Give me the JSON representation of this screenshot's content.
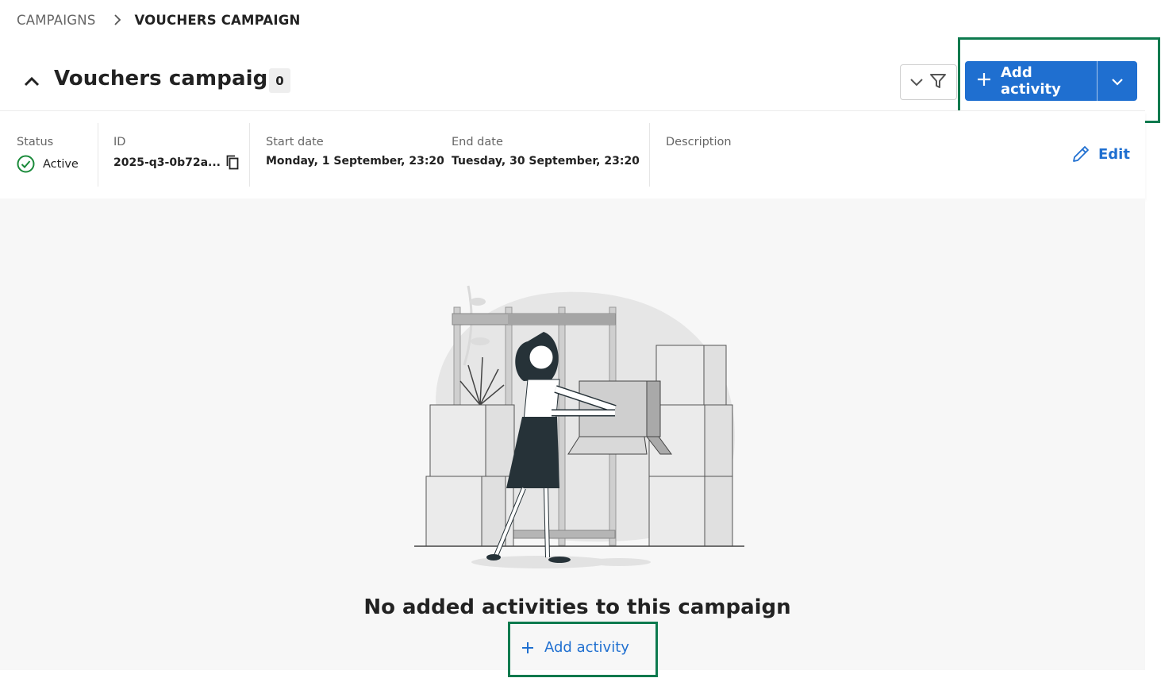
{
  "breadcrumb": {
    "parent": "CAMPAIGNS",
    "current": "VOUCHERS CAMPAIGN"
  },
  "header": {
    "title": "Vouchers campaign",
    "count": "0",
    "add_button_label": "Add activity"
  },
  "details": {
    "status_label": "Status",
    "status_value": "Active",
    "id_label": "ID",
    "id_value": "2025-q3-0b72a...",
    "start_label": "Start date",
    "start_value": "Monday, 1 September, 23:20",
    "end_label": "End date",
    "end_value": "Tuesday, 30 September, 23:20",
    "description_label": "Description",
    "edit_label": "Edit"
  },
  "empty_state": {
    "title": "No added activities to this campaign",
    "add_link_label": "Add activity"
  },
  "colors": {
    "accent": "#1f6fd0",
    "highlight": "#0d7a4e",
    "status_active": "#1a8a3a"
  },
  "icons": [
    "chevron-up-icon",
    "chevron-down-icon",
    "filter-icon",
    "plus-icon",
    "check-circle-icon",
    "copy-icon",
    "pencil-icon"
  ]
}
